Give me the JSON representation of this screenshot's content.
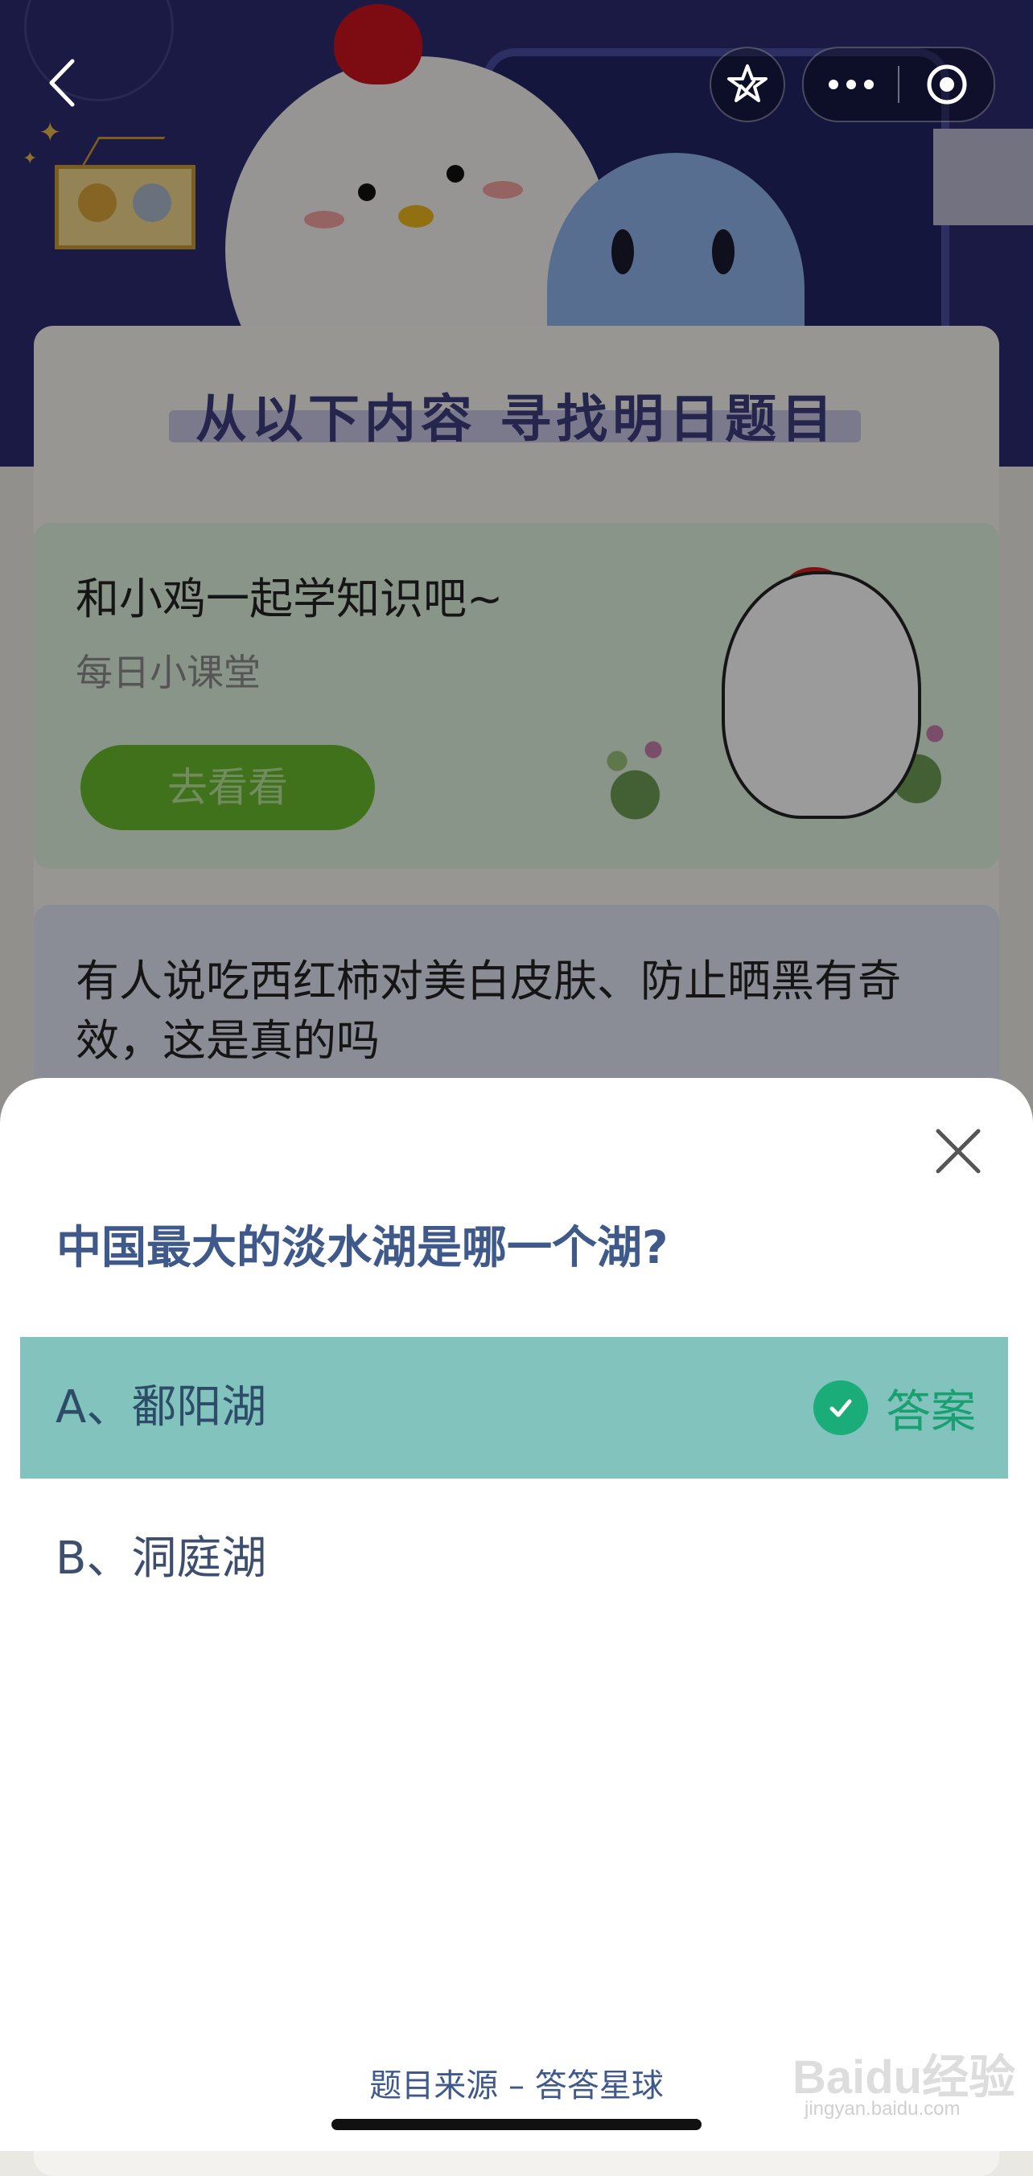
{
  "background": {
    "section_title": "从以下内容 寻找明日题目",
    "course_card": {
      "title": "和小鸡一起学知识吧~",
      "subtitle": "每日小课堂",
      "button_label": "去看看"
    },
    "question_card": {
      "text": "有人说吃西红柿对美白皮肤、防止晒黑有奇效，这是真的吗"
    }
  },
  "nav": {
    "back_icon": "chevron-left-icon",
    "favorite_icon": "star-icon",
    "more_icon": "more-dots-icon",
    "target_icon": "target-circle-icon"
  },
  "sheet": {
    "question": "中国最大的淡水湖是哪一个湖?",
    "options": [
      {
        "label": "A、鄱阳湖",
        "is_answer": true,
        "answer_tag": "答案"
      },
      {
        "label": "B、洞庭湖",
        "is_answer": false
      }
    ],
    "source": "题目来源 – 答答星球"
  },
  "watermark": {
    "brand": "Baidu经验",
    "url": "jingyan.baidu.com"
  },
  "colors": {
    "correct_bg": "#83c3be",
    "answer_green": "#19a070",
    "question_text": "#3f5a8a"
  }
}
